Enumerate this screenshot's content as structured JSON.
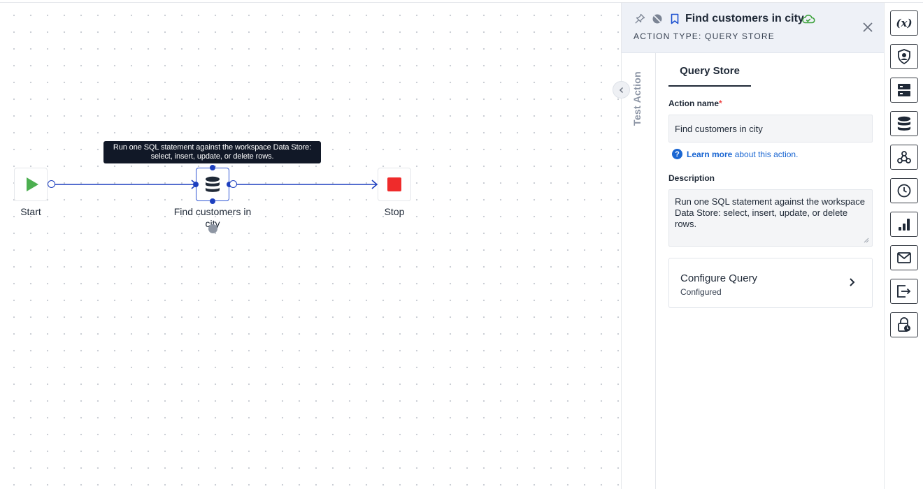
{
  "canvas": {
    "tooltip": {
      "line1": "Run one SQL statement against the workspace Data Store:",
      "line2": "select, insert, update, or delete rows."
    },
    "nodes": {
      "start_label": "Start",
      "query_label": "Find customers in city",
      "stop_label": "Stop"
    },
    "colors": {
      "edge": "#1d3fbf",
      "start": "#4caf50",
      "stop": "#ef2b2b"
    }
  },
  "panel": {
    "header": {
      "title": "Find customers in city",
      "subtitle": "ACTION TYPE: QUERY STORE",
      "icons": [
        "pin-icon",
        "disable-icon",
        "bookmark-icon",
        "cloud-check-icon",
        "close-icon"
      ]
    },
    "side_tab": {
      "label": "Test Action"
    },
    "tab": {
      "label": "Query Store"
    },
    "action_name": {
      "label": "Action name",
      "required_mark": "*",
      "value": "Find customers in city"
    },
    "learn_more": {
      "link": "Learn more",
      "rest": "about this action."
    },
    "description": {
      "label": "Description",
      "value": "Run one SQL statement against the workspace Data Store: select, insert, update, or delete rows."
    },
    "configure": {
      "title": "Configure Query",
      "status": "Configured"
    }
  },
  "toolbar": {
    "items": [
      {
        "icon": "variables-icon",
        "text": "(x)"
      },
      {
        "icon": "user-shield-icon"
      },
      {
        "icon": "server-icon"
      },
      {
        "icon": "database-icon"
      },
      {
        "icon": "webhook-icon"
      },
      {
        "icon": "clock-icon"
      },
      {
        "icon": "bar-chart-icon"
      },
      {
        "icon": "mail-icon"
      },
      {
        "icon": "exit-icon"
      },
      {
        "icon": "lock-clock-icon"
      }
    ]
  }
}
